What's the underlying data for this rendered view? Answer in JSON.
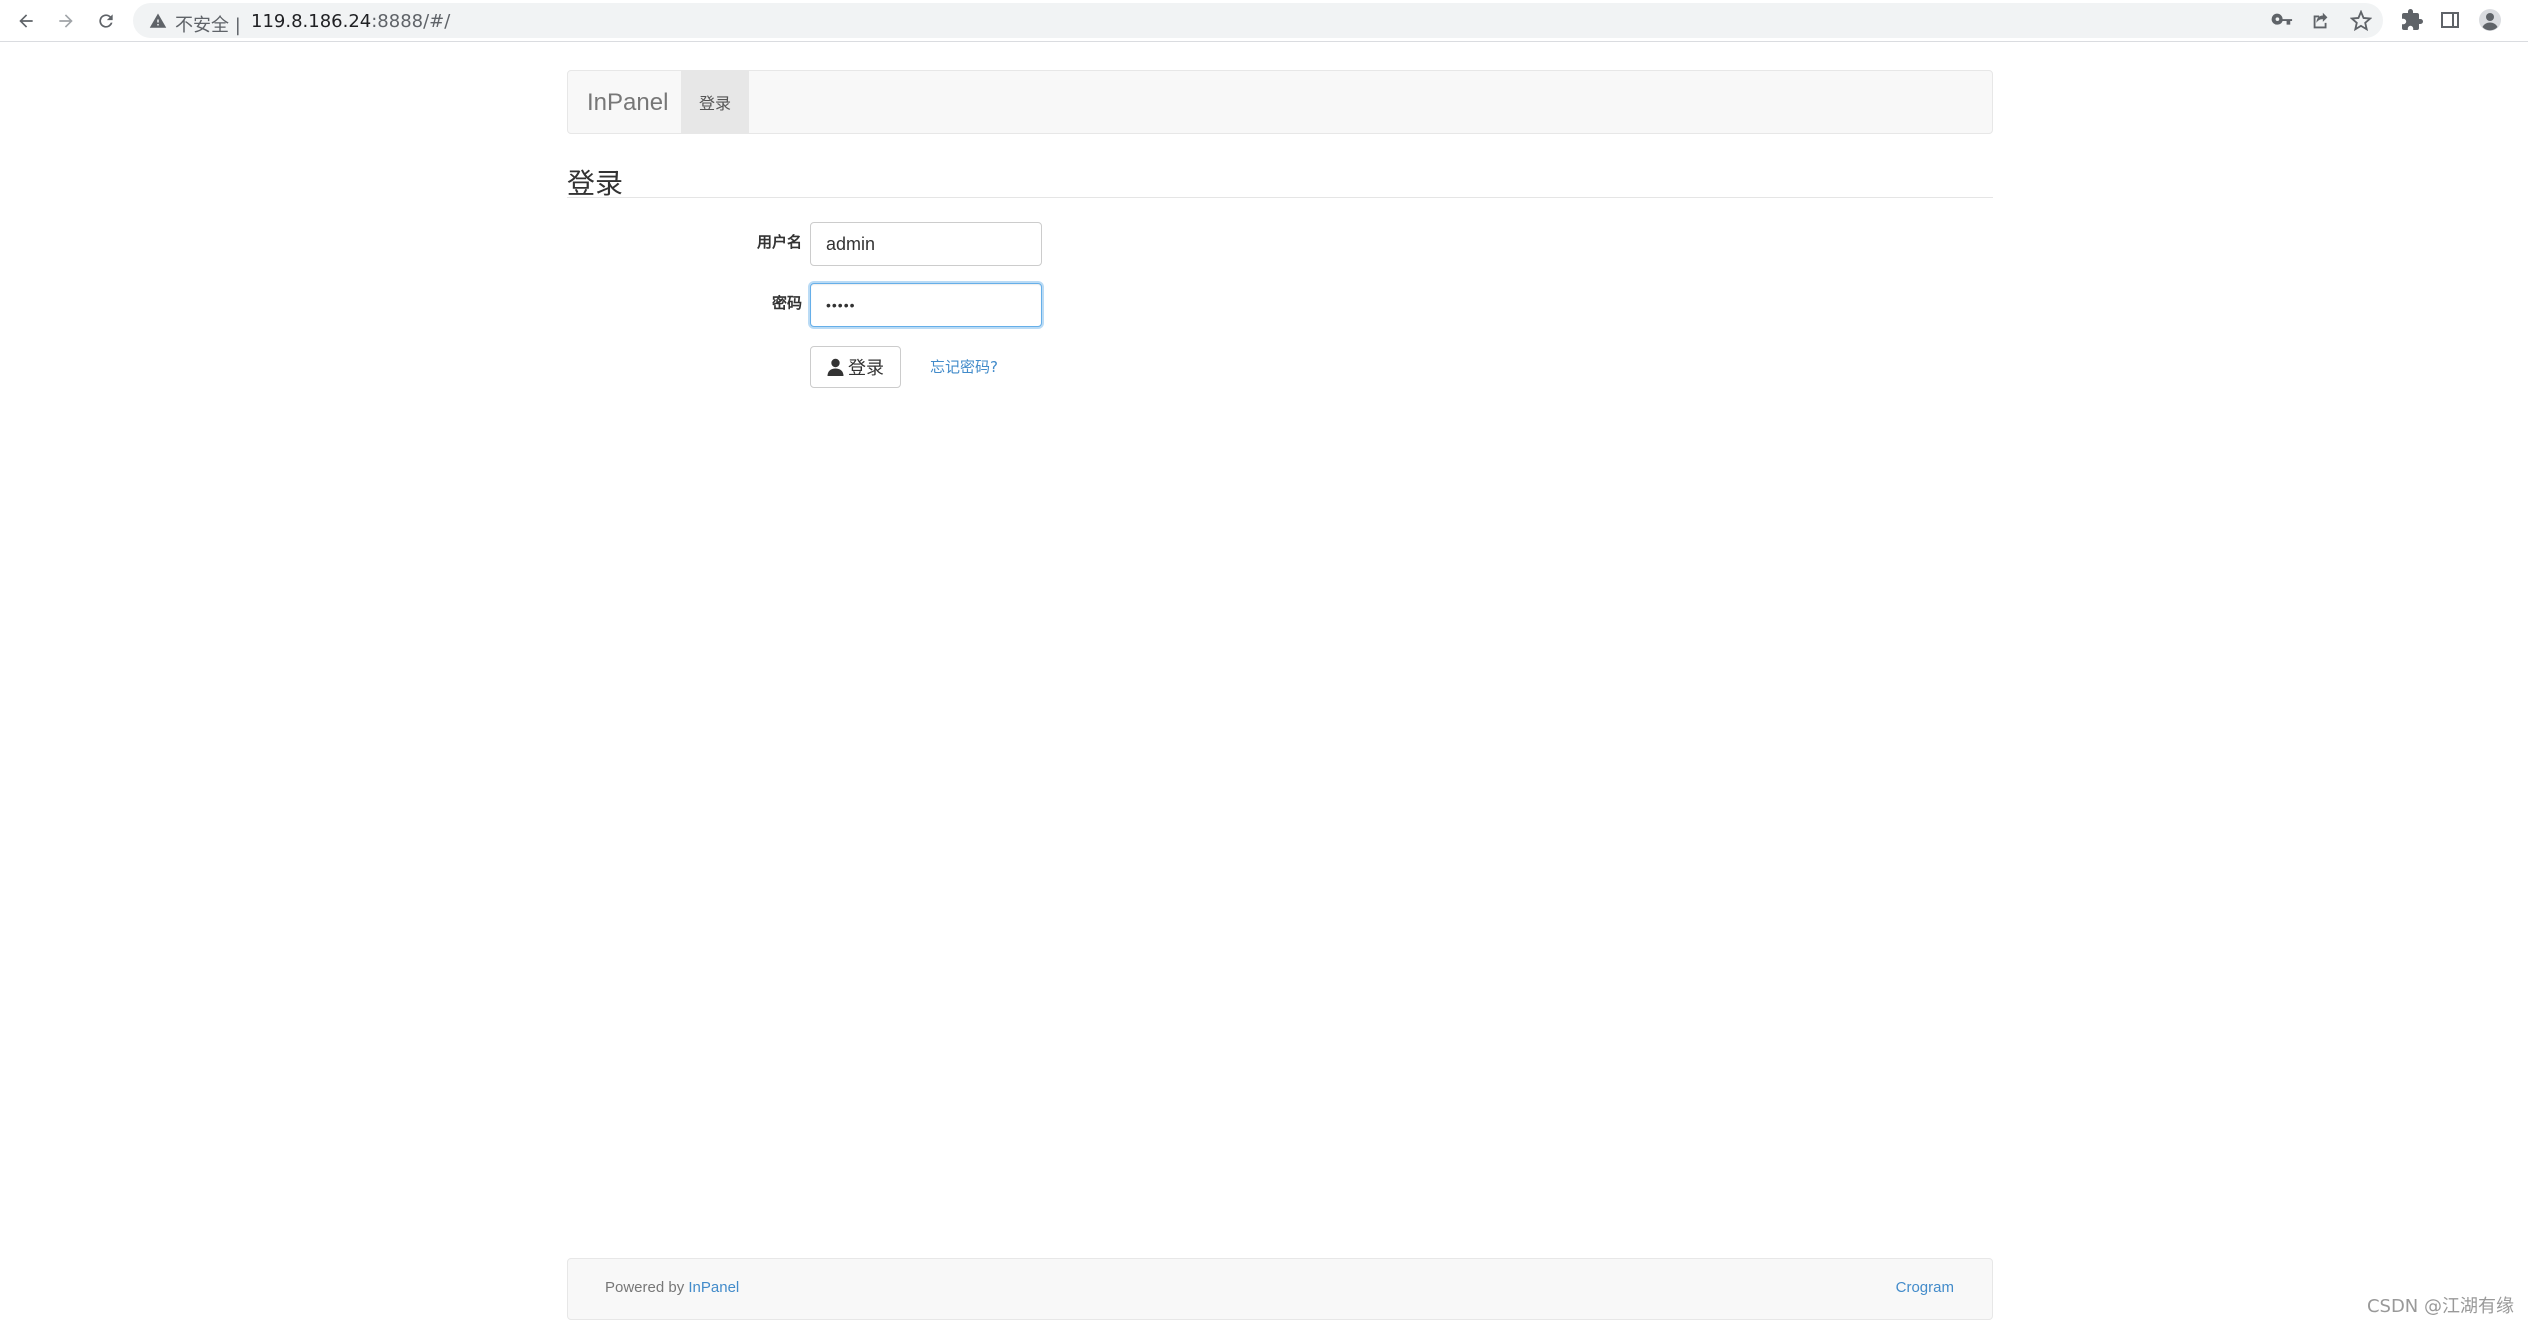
{
  "browser": {
    "security_text": "不安全 |",
    "url_host": "119.8.186.24",
    "url_path": ":8888/#/"
  },
  "navbar": {
    "brand": "InPanel",
    "active_item": "登录"
  },
  "page": {
    "heading": "登录"
  },
  "form": {
    "username_label": "用户名",
    "username_value": "admin",
    "password_label": "密码",
    "password_value": "•••••",
    "login_button": "登录",
    "forgot_link": "忘记密码?"
  },
  "footer": {
    "powered_by": "Powered by",
    "powered_link": "InPanel",
    "right_link": "Crogram"
  },
  "watermark": "CSDN @江湖有缘",
  "colors": {
    "link": "#428bca",
    "navbar_bg": "#f8f8f8",
    "focus_border": "#66afe9"
  }
}
